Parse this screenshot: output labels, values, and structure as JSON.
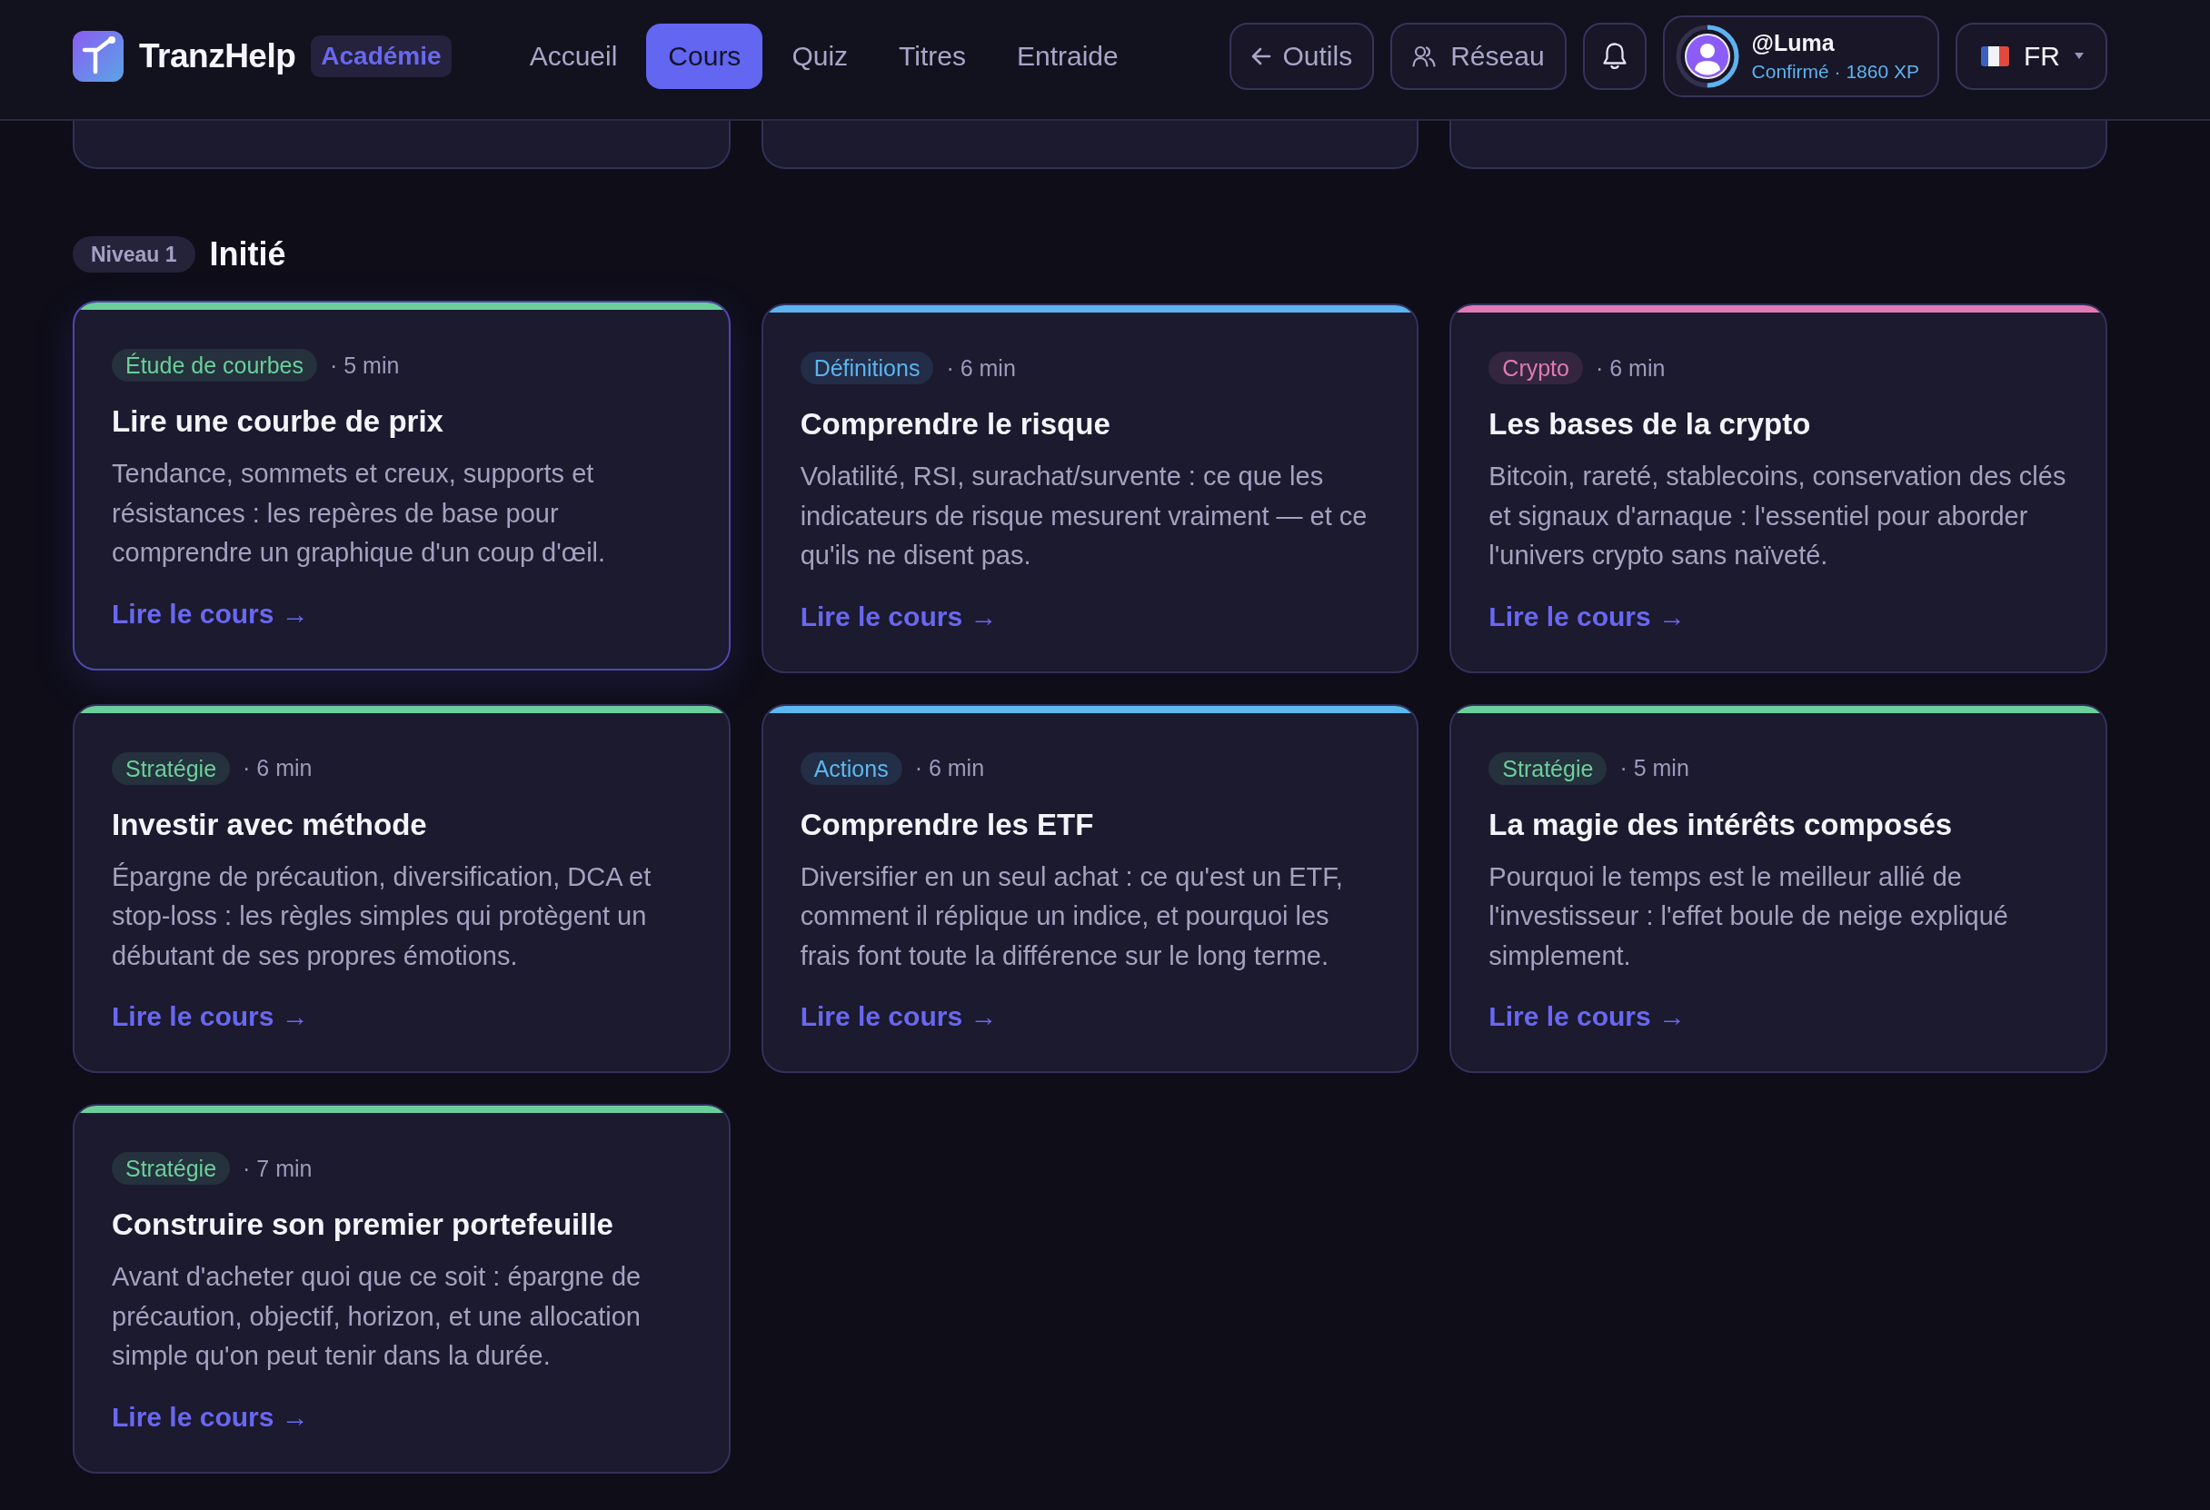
{
  "header": {
    "brand": "TranzHelp",
    "badge": "Académie",
    "nav": [
      {
        "label": "Accueil",
        "selected": false
      },
      {
        "label": "Cours",
        "selected": true
      },
      {
        "label": "Quiz",
        "selected": false
      },
      {
        "label": "Titres",
        "selected": false
      },
      {
        "label": "Entraide",
        "selected": false
      }
    ],
    "tools_button": "Outils",
    "network_button": "Réseau",
    "profile": {
      "handle": "@Luma",
      "rank": "Confirmé · 1860 XP",
      "level": 0.5
    },
    "language": "FR"
  },
  "section": {
    "level_badge": "Niveau 1",
    "title": "Initié"
  },
  "cards": [
    {
      "tag": "Étude de courbes",
      "color": "#6bcf9b",
      "meta": "· 5 min",
      "title": "Lire une courbe de prix",
      "description": "Tendance, sommets et creux, supports et résistances : les repères de base pour comprendre un graphique d'un coup d'œil.",
      "link": "Lire le cours →",
      "hovered": true
    },
    {
      "tag": "Définitions",
      "color": "#5cb3f0",
      "meta": "· 6 min",
      "title": "Comprendre le risque",
      "description": "Volatilité, RSI, surachat/survente : ce que les indicateurs de risque mesurent vraiment — et ce qu'ils ne disent pas.",
      "link": "Lire le cours →",
      "hovered": false
    },
    {
      "tag": "Crypto",
      "color": "#e07ab5",
      "meta": "· 6 min",
      "title": "Les bases de la crypto",
      "description": "Bitcoin, rareté, stablecoins, conservation des clés et signaux d'arnaque : l'essentiel pour aborder l'univers crypto sans naïveté.",
      "link": "Lire le cours →",
      "hovered": false
    },
    {
      "tag": "Stratégie",
      "color": "#6bcf9b",
      "meta": "· 6 min",
      "title": "Investir avec méthode",
      "description": "Épargne de précaution, diversification, DCA et stop-loss : les règles simples qui protègent un débutant de ses propres émotions.",
      "link": "Lire le cours →",
      "hovered": false
    },
    {
      "tag": "Actions",
      "color": "#5cb8ee",
      "meta": "· 6 min",
      "title": "Comprendre les ETF",
      "description": "Diversifier en un seul achat : ce qu'est un ETF, comment il réplique un indice, et pourquoi les frais font toute la différence sur le long terme.",
      "link": "Lire le cours →",
      "hovered": false
    },
    {
      "tag": "Stratégie",
      "color": "#6bcf9b",
      "meta": "· 5 min",
      "title": "La magie des intérêts composés",
      "description": "Pourquoi le temps est le meilleur allié de l'investisseur : l'effet boule de neige expliqué simplement.",
      "link": "Lire le cours →",
      "hovered": false
    },
    {
      "tag": "Stratégie",
      "color": "#6bcf9b",
      "meta": "· 7 min",
      "title": "Construire son premier portefeuille",
      "description": "Avant d'acheter quoi que ce soit : épargne de précaution, objectif, horizon, et une allocation simple qu'on peut tenir dans la durée.",
      "link": "Lire le cours →",
      "hovered": false
    }
  ]
}
